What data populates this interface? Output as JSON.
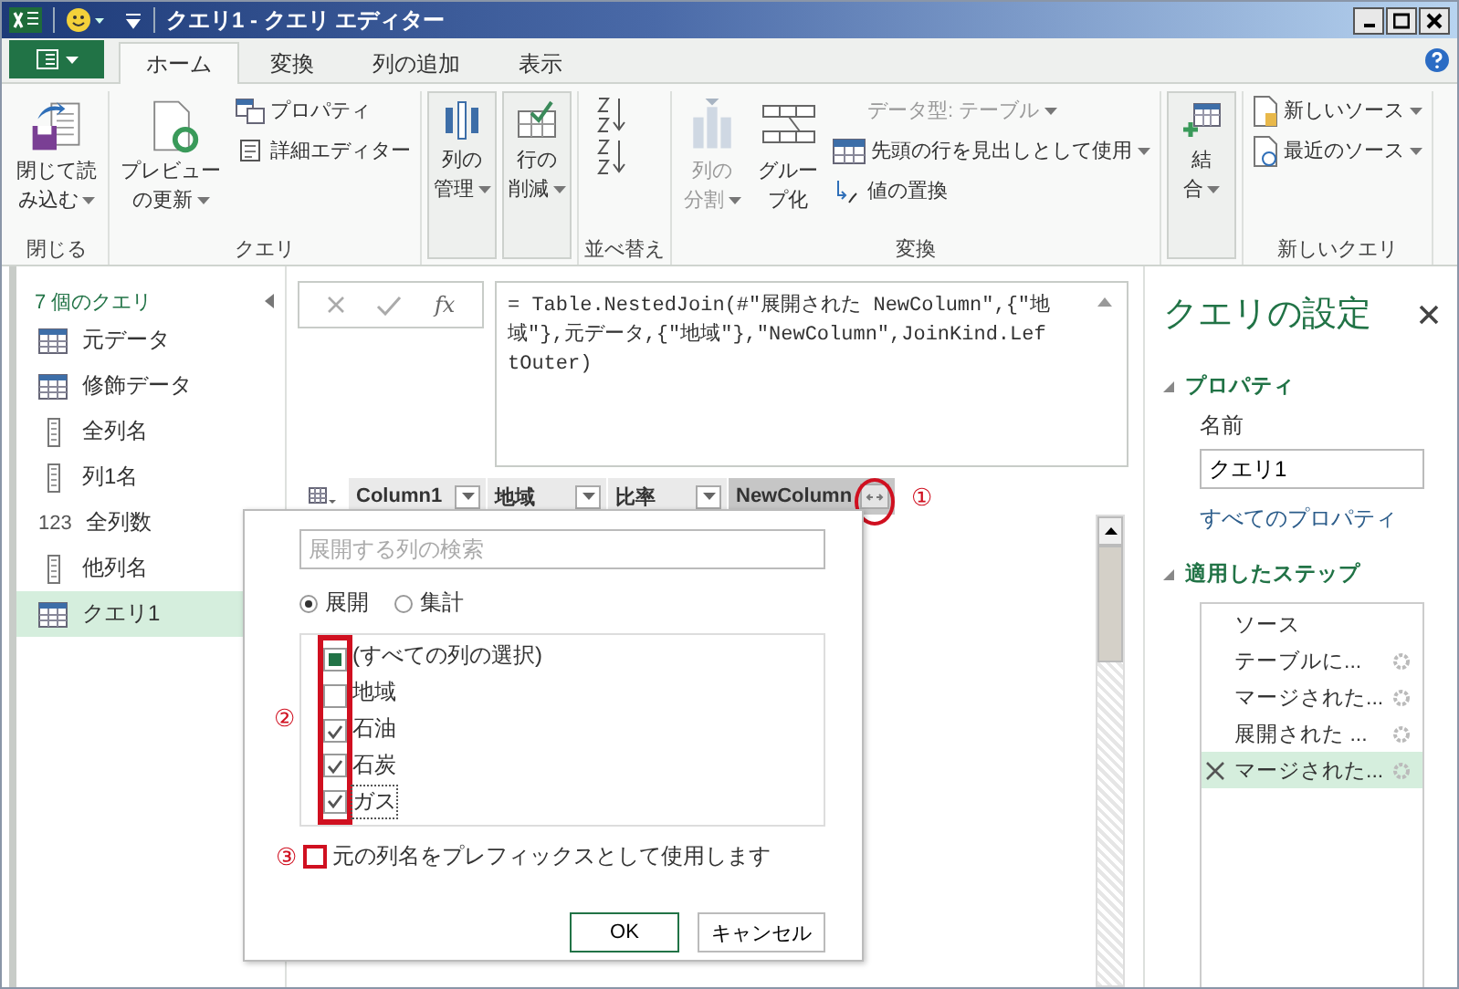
{
  "window": {
    "title": "クエリ1 - クエリ エディター"
  },
  "ribbon_tabs": [
    {
      "label": "ホーム",
      "selected": true
    },
    {
      "label": "変換",
      "selected": false
    },
    {
      "label": "列の追加",
      "selected": false
    },
    {
      "label": "表示",
      "selected": false
    }
  ],
  "ribbon_groups": [
    {
      "label": "閉じる",
      "items": [
        {
          "kind": "large",
          "lines": [
            "閉じて読",
            "み込む"
          ],
          "menu": true,
          "disabled": false,
          "highlighted": false
        }
      ]
    },
    {
      "label": "クエリ",
      "items": [
        {
          "kind": "large",
          "lines": [
            "プレビュー",
            "の更新"
          ],
          "menu": true,
          "disabled": false,
          "highlighted": false
        },
        {
          "kind": "stack",
          "children": [
            {
              "label": "プロパティ",
              "menu": false,
              "disabled": false
            },
            {
              "label": "詳細エディター",
              "menu": false,
              "disabled": false
            }
          ]
        }
      ]
    },
    {
      "items": [
        {
          "kind": "large",
          "lines": [
            "列の",
            "管理"
          ],
          "menu": true,
          "disabled": false,
          "highlighted": true
        },
        {
          "kind": "large",
          "lines": [
            "行の",
            "削減"
          ],
          "menu": true,
          "disabled": false,
          "highlighted": true
        }
      ]
    },
    {
      "label": "並べ替え",
      "items": [
        {
          "kind": "sort"
        }
      ]
    },
    {
      "label": "変換",
      "items": [
        {
          "kind": "large",
          "lines": [
            "列の",
            "分割"
          ],
          "menu": true,
          "disabled": true,
          "highlighted": false
        },
        {
          "kind": "large",
          "lines": [
            "グルー",
            "プ化"
          ],
          "menu": false,
          "disabled": false,
          "highlighted": false
        },
        {
          "kind": "stack",
          "children": [
            {
              "label": "データ型: テーブル",
              "menu": true,
              "disabled": true
            },
            {
              "label": "先頭の行を見出しとして使用",
              "menu": true,
              "disabled": false
            },
            {
              "label": "値の置換",
              "menu": false,
              "disabled": false
            }
          ]
        }
      ]
    },
    {
      "items": [
        {
          "kind": "large",
          "lines": [
            "結",
            "合"
          ],
          "menu": true,
          "disabled": false,
          "highlighted": true
        }
      ]
    },
    {
      "label": "新しいクエリ",
      "items": [
        {
          "kind": "stack",
          "children": [
            {
              "label": "新しいソース",
              "menu": true,
              "disabled": false
            },
            {
              "label": "最近のソース",
              "menu": true,
              "disabled": false
            }
          ]
        }
      ]
    }
  ],
  "queries": {
    "title": "7 個のクエリ",
    "items": [
      {
        "kind": "table",
        "label": "元データ",
        "selected": false
      },
      {
        "kind": "table",
        "label": "修飾データ",
        "selected": false
      },
      {
        "kind": "list",
        "label": "全列名",
        "selected": false
      },
      {
        "kind": "list",
        "label": "列1名",
        "selected": false
      },
      {
        "kind": "number",
        "type_label": "123",
        "label": "全列数",
        "selected": false
      },
      {
        "kind": "list",
        "label": "他列名",
        "selected": false
      },
      {
        "kind": "table",
        "label": "クエリ1",
        "selected": true
      }
    ]
  },
  "formula_bar": {
    "fx_label": "fx",
    "formula": "= Table.NestedJoin(#\"展開された NewColumn\",{\"地域\"},元データ,{\"地域\"},\"NewColumn\",JoinKind.LeftOuter)"
  },
  "table": {
    "columns": [
      {
        "label": "Column1",
        "selected": false,
        "expand": false
      },
      {
        "label": "地域",
        "selected": false,
        "expand": false
      },
      {
        "label": "比率",
        "selected": false,
        "expand": false
      },
      {
        "label": "NewColumn",
        "selected": true,
        "expand": true
      }
    ]
  },
  "expand_dialog": {
    "search": {
      "placeholder": "展開する列の検索"
    },
    "modes": [
      {
        "label": "展開",
        "selected": true
      },
      {
        "label": "集計",
        "selected": false
      }
    ],
    "columns": [
      {
        "label": "(すべての列の選択)",
        "checked": false,
        "indeterminate": true,
        "focused": false
      },
      {
        "label": "地域",
        "checked": false,
        "focused": false
      },
      {
        "label": "石油",
        "checked": true,
        "focused": false
      },
      {
        "label": "石炭",
        "checked": true,
        "focused": false
      },
      {
        "label": "ガス",
        "checked": true,
        "focused": true
      }
    ],
    "prefix": {
      "label": "元の列名をプレフィックスとして使用します",
      "checked": false
    },
    "buttons": [
      {
        "label": "OK",
        "primary": true
      },
      {
        "label": "キャンセル",
        "primary": false
      }
    ]
  },
  "annotations": [
    "①",
    "②",
    "③"
  ],
  "settings": {
    "title": "クエリの設定",
    "properties_heading": "プロパティ",
    "name_label": "名前",
    "name_value": "クエリ1",
    "all_properties_link": "すべてのプロパティ",
    "steps_heading": "適用したステップ",
    "steps": [
      {
        "label": "ソース",
        "settings": false,
        "selected": false
      },
      {
        "label": "テーブルに...",
        "settings": true,
        "selected": false
      },
      {
        "label": "マージされた...",
        "settings": true,
        "selected": false
      },
      {
        "label": "展開された ...",
        "settings": true,
        "selected": false
      },
      {
        "label": "マージされた...",
        "settings": true,
        "selected": true
      }
    ]
  }
}
